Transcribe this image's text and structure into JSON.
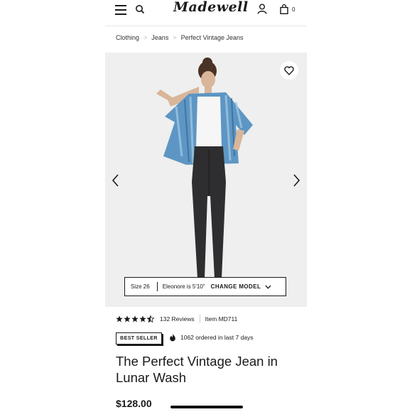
{
  "header": {
    "logo": "Madewell",
    "bag_count": "0"
  },
  "breadcrumb": [
    "Clothing",
    "Jeans",
    "Perfect Vintage Jeans"
  ],
  "model_bar": {
    "size": "Size 26",
    "model_info": "Eleonore is 5'10\"",
    "change_label": "CHANGE MODEL"
  },
  "product": {
    "rating": 4.5,
    "reviews": "132 Reviews",
    "item": "Item MD711",
    "badge": "BEST SELLER",
    "ordered": "1062 ordered in last 7 days",
    "title": "The Perfect Vintage Jean in Lunar Wash",
    "price": "$128.00"
  },
  "colors": {
    "text": "#1a1a1a",
    "hero_bg": "#eeefee",
    "shirt": "#5d96c4",
    "jeans": "#2e2e30"
  },
  "icons": [
    "menu-icon",
    "search-icon",
    "account-icon",
    "bag-icon",
    "heart-icon",
    "chevron-left-icon",
    "chevron-right-icon",
    "chevron-down-icon",
    "star-icon",
    "flame-icon"
  ]
}
